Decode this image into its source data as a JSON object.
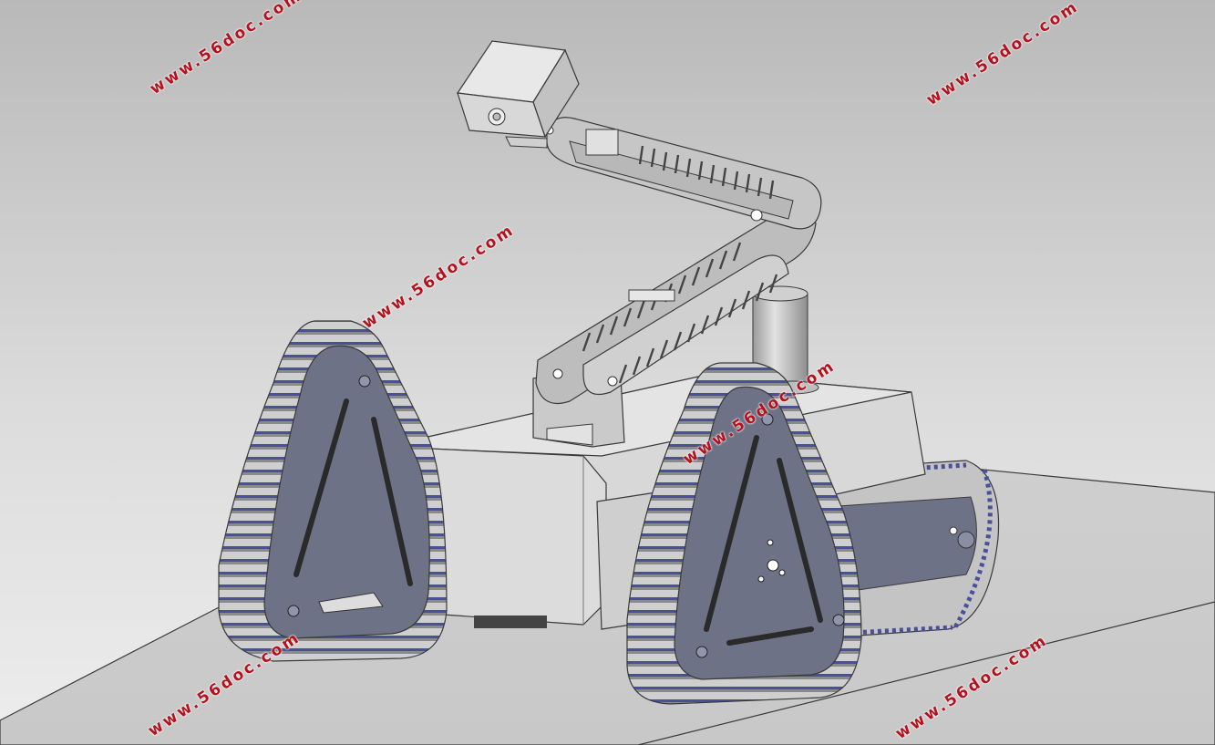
{
  "watermark": {
    "text": "www.56doc.com",
    "color": "#b3121e"
  },
  "scene": {
    "subject": "tracked-robot-cad-model",
    "colors": {
      "background_top": "#bdbdbd",
      "background_bottom": "#e8e8e8",
      "floor": "#d4d4d4",
      "body": "#d6d6d6",
      "side_plate": "#6e7287",
      "track": "#c9c9c9",
      "track_link": "#4a4f9a",
      "outline": "#3a3a3a"
    }
  }
}
